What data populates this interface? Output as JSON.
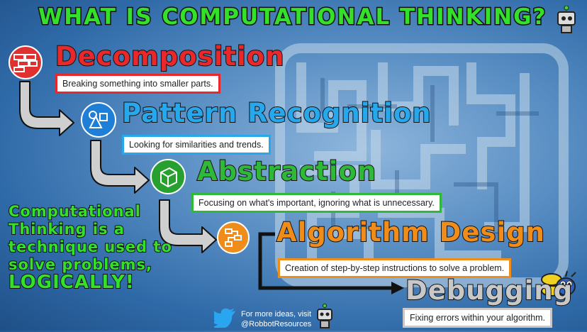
{
  "title": "WHAT IS COMPUTATIONAL THINKING?",
  "steps": [
    {
      "heading": "Decomposition",
      "description": "Breaking something into smaller parts.",
      "color": "#e8282a",
      "icon": "bricks-icon"
    },
    {
      "heading": "Pattern Recognition",
      "description": "Looking for similarities and trends.",
      "color": "#28a8ec",
      "icon": "shapes-icon"
    },
    {
      "heading": "Abstraction",
      "description": "Focusing on what's important, ignoring what is unnecessary.",
      "color": "#30b838",
      "icon": "cube-icon"
    },
    {
      "heading": "Algorithm Design",
      "description": "Creation of step-by-step instructions to solve a problem.",
      "color": "#f08c1a",
      "icon": "flowchart-icon"
    },
    {
      "heading": "Debugging",
      "description": "Fixing errors within your algorithm.",
      "color": "#c8c8c8",
      "icon": "bug-icon"
    }
  ],
  "summary": {
    "lines": [
      "Computational",
      "Thinking is a",
      "technique used to",
      "solve problems,"
    ],
    "emphasis": "LOGICALLY!"
  },
  "credit": {
    "line1": "For more ideas, visit",
    "line2": "@RobbotResources",
    "icon": "twitter-bird-icon"
  }
}
